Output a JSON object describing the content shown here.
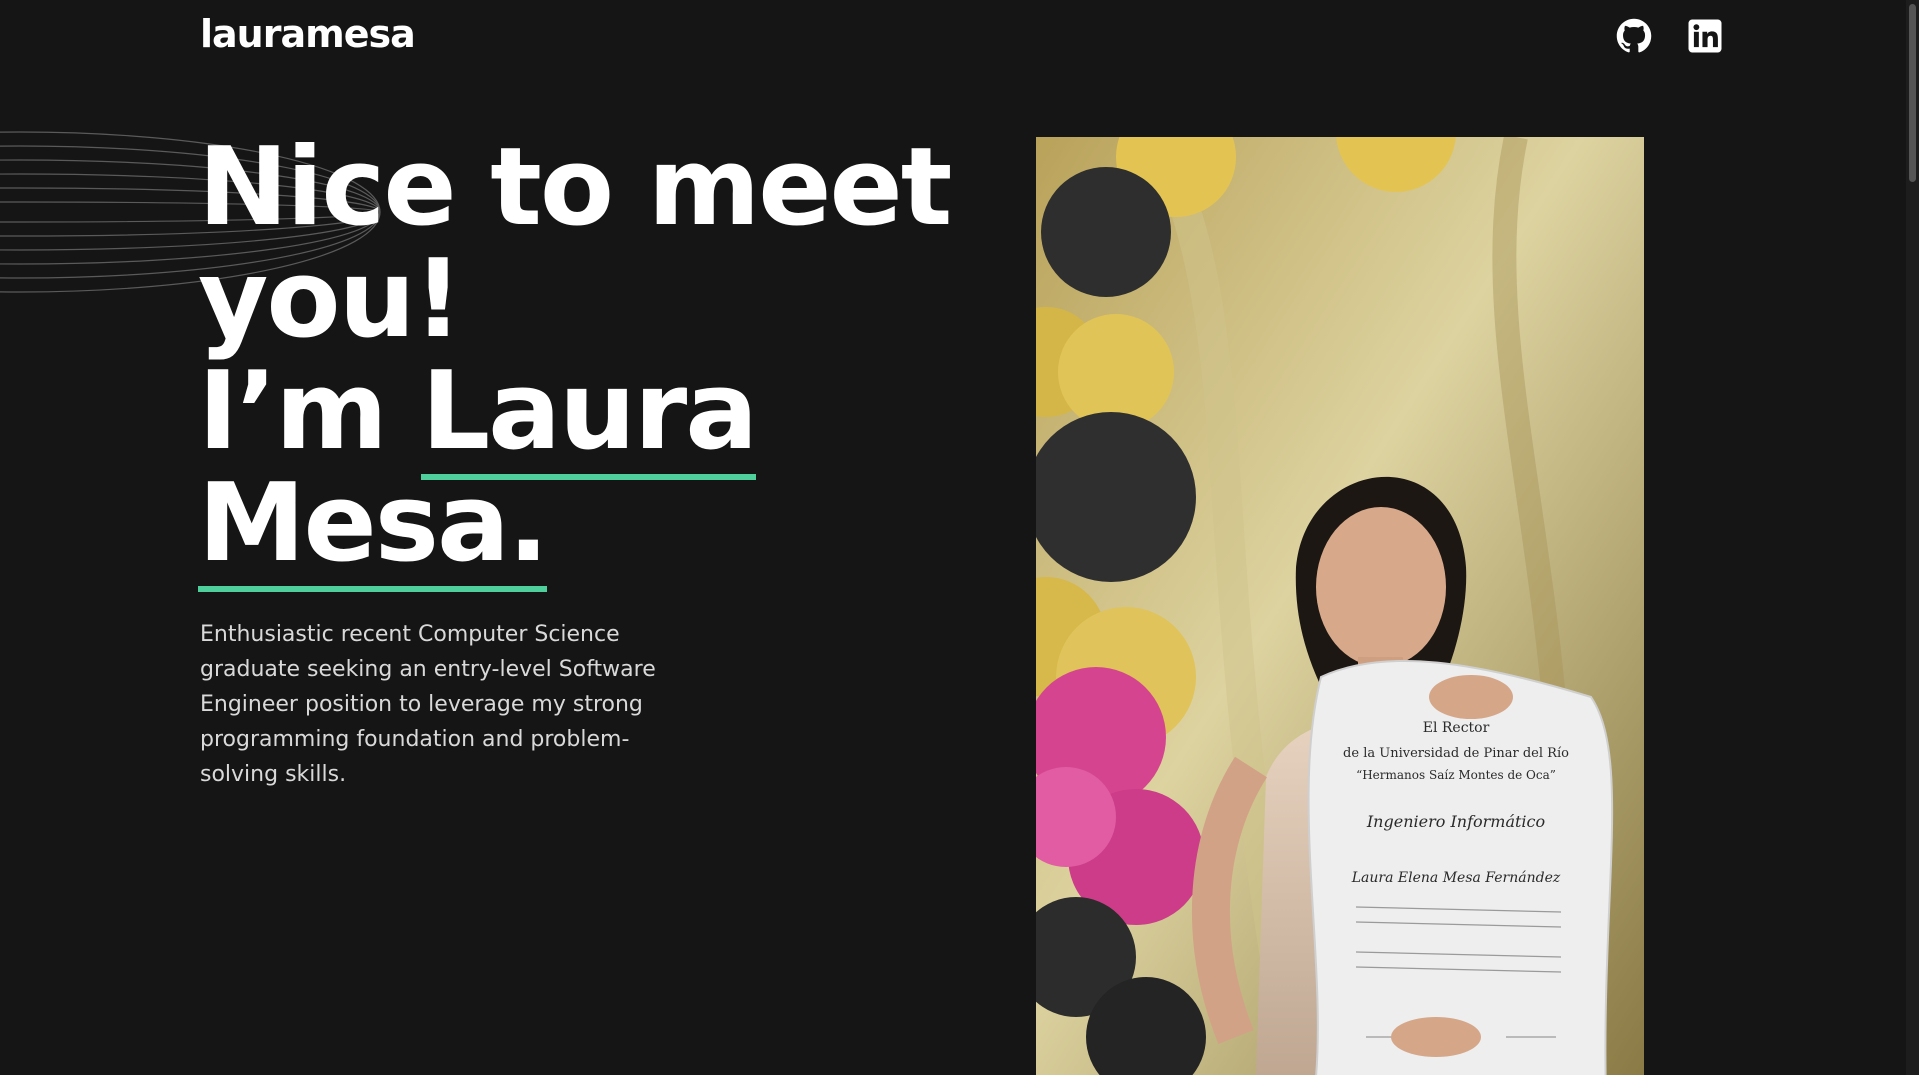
{
  "header": {
    "logo": "lauramesa",
    "social": [
      {
        "icon": "github-icon"
      },
      {
        "icon": "linkedin-icon"
      }
    ]
  },
  "hero": {
    "title_line1": "Nice to meet",
    "title_line2": "you!",
    "title_line3_prefix": "I’m ",
    "title_name_first": "Laura",
    "title_name_last": "Mesa.",
    "description": "Enthusiastic recent Computer Science graduate seeking an entry-level Software Engineer position to leverage my strong programming foundation and problem-solving skills."
  },
  "photo": {
    "diploma_line1": "El Rector",
    "diploma_line2": "de la Universidad de Pinar del Río",
    "diploma_line3": "“Hermanos Saíz Montes de Oca”",
    "diploma_degree": "Ingeniero Informático",
    "diploma_name": "Laura Elena Mesa Fernández"
  },
  "colors": {
    "background": "#151515",
    "accent": "#4ecf9b",
    "text": "#ffffff",
    "muted_text": "#d9d9d9"
  }
}
